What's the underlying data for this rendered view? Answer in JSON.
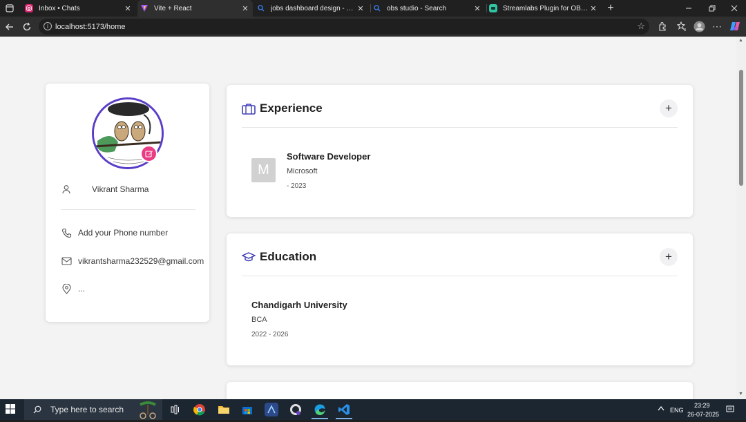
{
  "browser": {
    "tabs": [
      {
        "title": "Inbox • Chats",
        "icon": "instagram-icon",
        "color": "#d6246e"
      },
      {
        "title": "Vite + React",
        "icon": "vite-icon",
        "color": "#a855f7"
      },
      {
        "title": "jobs dashboard design - Search",
        "icon": "search-icon",
        "color": "#3b82f6"
      },
      {
        "title": "obs studio - Search",
        "icon": "search-icon",
        "color": "#3b82f6"
      },
      {
        "title": "Streamlabs Plugin for OBS | Add A",
        "icon": "streamlabs-icon",
        "color": "#31c3a2"
      }
    ],
    "url": "localhost:5173/home"
  },
  "profile": {
    "name": "Vikrant Sharma",
    "phone": "Add your Phone number",
    "email": "vikrantsharma232529@gmail.com",
    "location": "..."
  },
  "experience": {
    "title": "Experience",
    "entry": {
      "logo_letter": "M",
      "role": "Software Developer",
      "company": "Microsoft",
      "dates": "- 2023"
    }
  },
  "education": {
    "title": "Education",
    "entry": {
      "institution": "Chandigarh University",
      "degree": "BCA",
      "dates": "2022 - 2026"
    }
  },
  "taskbar": {
    "search_placeholder": "Type here to search",
    "language": "ENG",
    "time": "23:29",
    "date": "26-07-2025"
  },
  "colors": {
    "accent_purple": "#5b3ec8",
    "edit_pink": "#e83d84",
    "icon_indigo": "#3f3fb8"
  }
}
